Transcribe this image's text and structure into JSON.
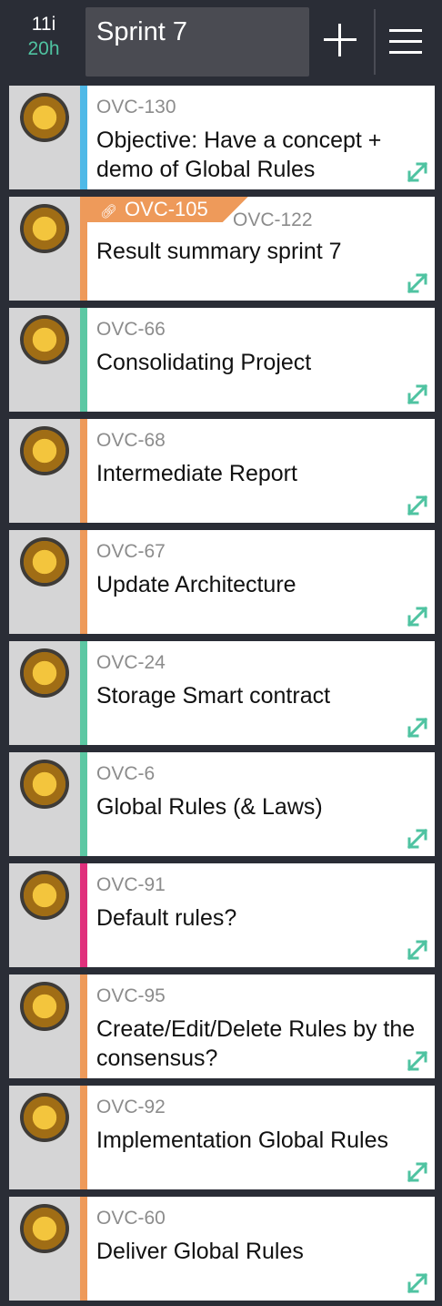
{
  "header": {
    "issue_count": "11i",
    "hours": "20h",
    "sprint_title": "Sprint 7",
    "add_icon": "plus-icon",
    "menu_icon": "hamburger-menu-icon"
  },
  "colors": {
    "blue": "#4fb9e7",
    "orange": "#ee9a5a",
    "green": "#5cc8a3",
    "pink": "#e0307c",
    "accent": "#4fc3a1"
  },
  "cards": [
    {
      "key": "OVC-130",
      "summary": "Objective: Have a concept + demo of Global Rules",
      "color": "blue"
    },
    {
      "key": "OVC-122",
      "summary": "Result summary sprint 7",
      "color": "orange",
      "parent": "OVC-105"
    },
    {
      "key": "OVC-66",
      "summary": "Consolidating Project",
      "color": "green"
    },
    {
      "key": "OVC-68",
      "summary": "Intermediate Report",
      "color": "orange"
    },
    {
      "key": "OVC-67",
      "summary": "Update Architecture",
      "color": "orange"
    },
    {
      "key": "OVC-24",
      "summary": "Storage Smart contract",
      "color": "green"
    },
    {
      "key": "OVC-6",
      "summary": "Global Rules (& Laws)",
      "color": "green"
    },
    {
      "key": "OVC-91",
      "summary": "Default rules?",
      "color": "pink"
    },
    {
      "key": "OVC-95",
      "summary": "Create/Edit/Delete Rules by the consensus?",
      "color": "orange"
    },
    {
      "key": "OVC-92",
      "summary": "Implementation Global Rules",
      "color": "orange"
    },
    {
      "key": "OVC-60",
      "summary": "Deliver Global Rules",
      "color": "orange"
    }
  ]
}
